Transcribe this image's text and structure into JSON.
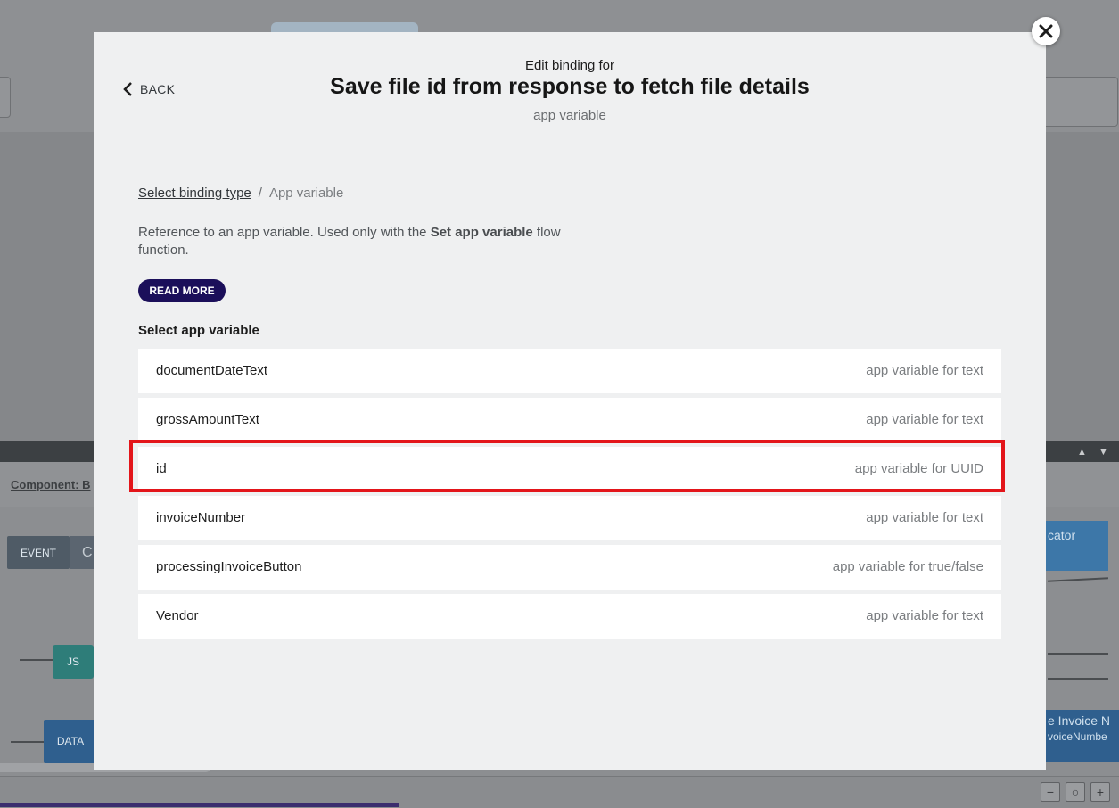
{
  "background": {
    "component_label": "Component: B",
    "nodes": {
      "event": "EVENT",
      "event_extra": "C",
      "js": "JS",
      "data": "DATA",
      "right_top": "cator",
      "right_bottom_title": "e Invoice N",
      "right_bottom_sub": "voiceNumbe"
    },
    "zoom": {
      "minus": "−",
      "reset": "○",
      "plus": "+"
    }
  },
  "modal": {
    "close_icon": "close-icon",
    "back_label": "BACK",
    "header": {
      "pre_title": "Edit binding for",
      "title": "Save file id from response to fetch file details",
      "subtitle": "app variable"
    },
    "breadcrumb": {
      "link": "Select binding type",
      "separator": "/",
      "current": "App variable"
    },
    "description": {
      "prefix": "Reference to an app variable. Used only with the ",
      "bold": "Set app variable",
      "suffix": " flow function."
    },
    "read_more_label": "READ MORE",
    "section_label": "Select app variable",
    "variables": [
      {
        "name": "documentDateText",
        "type": "app variable for text"
      },
      {
        "name": "grossAmountText",
        "type": "app variable for text"
      },
      {
        "name": "id",
        "type": "app variable for UUID",
        "highlighted": true
      },
      {
        "name": "invoiceNumber",
        "type": "app variable for text"
      },
      {
        "name": "processingInvoiceButton",
        "type": "app variable for true/false"
      },
      {
        "name": "Vendor",
        "type": "app variable for text"
      }
    ]
  },
  "colors": {
    "read_more_bg": "#1b0f5a",
    "highlight_border": "#e3151a",
    "overlay": "#8c8e91"
  }
}
